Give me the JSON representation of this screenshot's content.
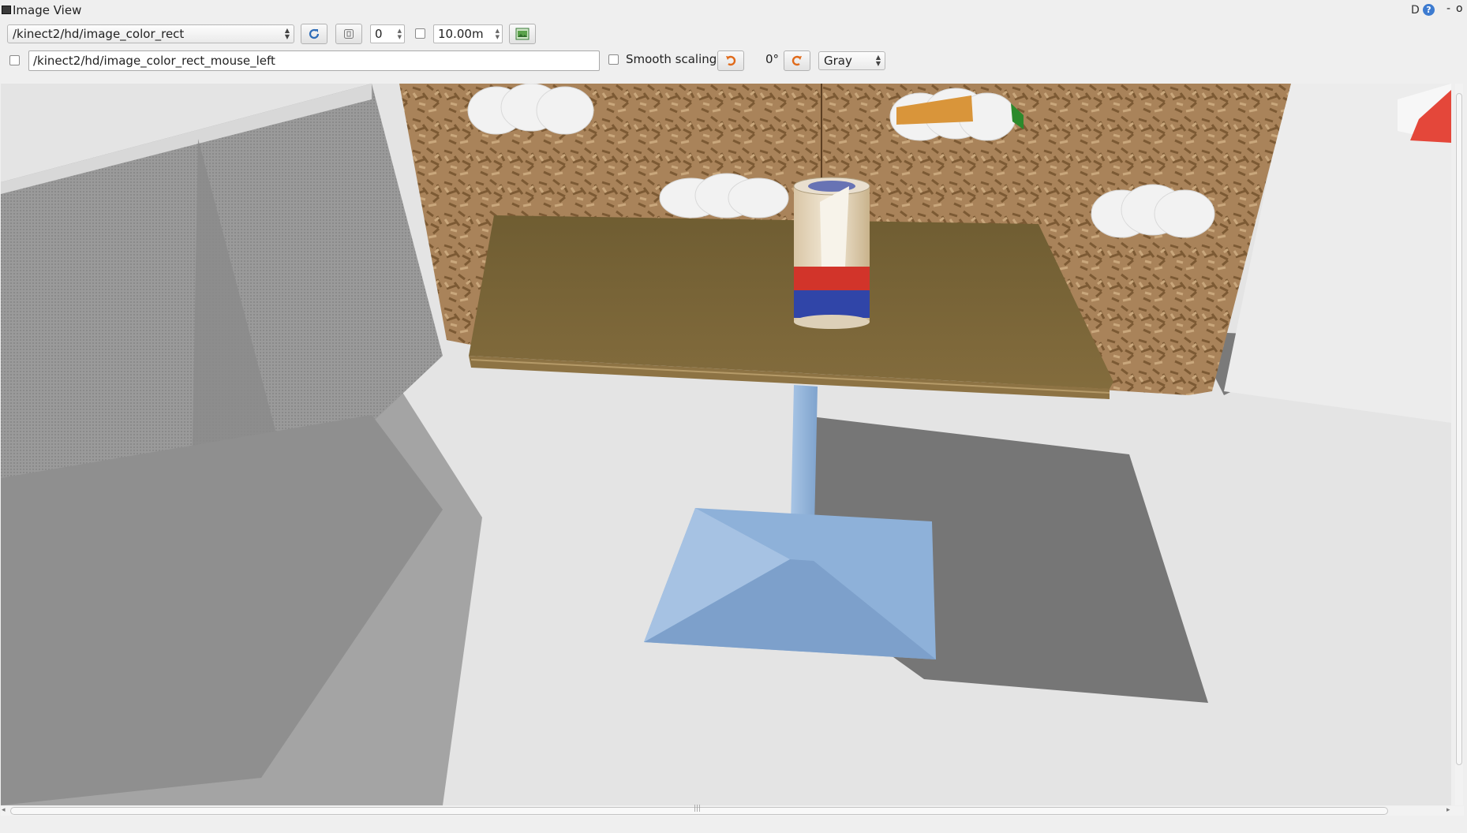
{
  "window": {
    "title": "Image View",
    "help_d": "D",
    "help_q": "?",
    "min": "-",
    "close": "o"
  },
  "toolbar": {
    "topic": "/kinect2/hd/image_color_rect",
    "frame_value": "0",
    "max_range": "10.00m",
    "mouse_topic": "/kinect2/hd/image_color_rect_mouse_left",
    "smooth_scaling_label": "Smooth scaling",
    "rotation": "0°",
    "colormap": "Gray"
  },
  "icons": {
    "refresh": "refresh-icon",
    "zoom": "zoom-fit-icon",
    "save": "save-image-icon",
    "rotate_left": "rotate-left-icon",
    "rotate_right": "rotate-right-icon"
  },
  "colors": {
    "floor": "#e6e6e6",
    "wall_shadow": "#8d8d8d",
    "osb_board": "#a9835a",
    "table_top": "#7d6a3a",
    "table_leg": "#8fb3da",
    "can_blue": "#3045a8",
    "can_red": "#d2342a"
  }
}
